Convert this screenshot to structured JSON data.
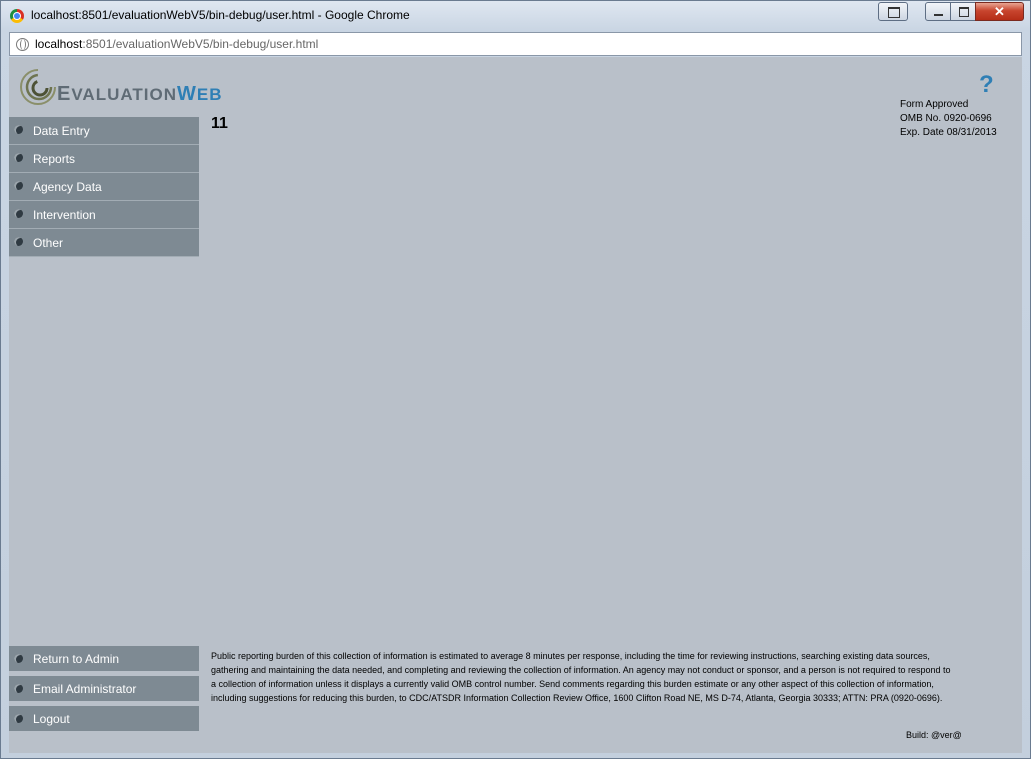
{
  "window": {
    "title": "localhost:8501/evaluationWebV5/bin-debug/user.html - Google Chrome",
    "close_glyph": "✕"
  },
  "address": {
    "host": "localhost",
    "path": ":8501/evaluationWebV5/bin-debug/user.html"
  },
  "logo": {
    "first_letter": "E",
    "text": "VALUATION",
    "web_letter": "W",
    "web_rest": "EB"
  },
  "help": {
    "label": "?"
  },
  "form_info": {
    "line1": "Form Approved",
    "line2": "OMB No. 0920-0696",
    "line3": "Exp. Date 08/31/2013"
  },
  "nav": {
    "items": [
      {
        "label": "Data Entry"
      },
      {
        "label": "Reports"
      },
      {
        "label": "Agency Data"
      },
      {
        "label": "Intervention"
      },
      {
        "label": "Other"
      }
    ]
  },
  "content": {
    "number": "11"
  },
  "bottom_nav": {
    "return_admin": "Return to Admin",
    "email_admin": "Email Administrator",
    "logout": "Logout"
  },
  "burden_text": "Public reporting burden of this collection of information is estimated to average 8 minutes per response, including the time for reviewing instructions, searching existing data sources, gathering and maintaining the data needed, and completing and reviewing the collection of information.  An agency may not conduct or sponsor, and a person is not required to respond to a collection of information unless it displays a currently valid OMB control number.  Send comments regarding this burden estimate or any other aspect of this collection of information, including suggestions for reducing this burden, to CDC/ATSDR Information Collection Review Office, 1600 Clifton Road NE, MS D-74, Atlanta, Georgia 30333; ATTN: PRA (0920-0696).",
  "build": "Build: @ver@",
  "colors": {
    "accent": "#2f7fb5",
    "nav_bg": "#7e8a93",
    "page_bg": "#b9c0c9"
  }
}
